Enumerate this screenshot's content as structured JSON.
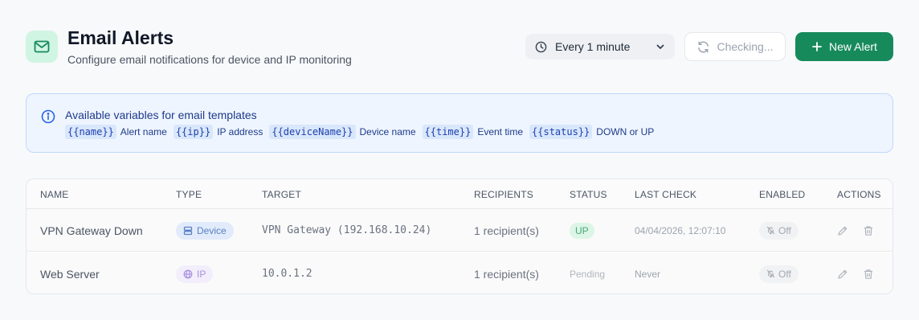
{
  "header": {
    "title": "Email Alerts",
    "subtitle": "Configure email notifications for device and IP monitoring",
    "icon": "mail-icon",
    "accent_color": "#178a5c"
  },
  "toolbar": {
    "interval_label": "Every 1 minute",
    "checking_label": "Checking...",
    "new_alert_label": "New Alert"
  },
  "info": {
    "title": "Available variables for email templates",
    "variables": [
      {
        "code": "{{name}}",
        "desc": "Alert name"
      },
      {
        "code": "{{ip}}",
        "desc": "IP address"
      },
      {
        "code": "{{deviceName}}",
        "desc": "Device name"
      },
      {
        "code": "{{time}}",
        "desc": "Event time"
      },
      {
        "code": "{{status}}",
        "desc": "DOWN or UP"
      }
    ]
  },
  "table": {
    "columns": [
      "NAME",
      "TYPE",
      "TARGET",
      "RECIPIENTS",
      "STATUS",
      "LAST CHECK",
      "ENABLED",
      "ACTIONS"
    ],
    "rows": [
      {
        "name": "VPN Gateway Down",
        "type": "Device",
        "target": "VPN Gateway (192.168.10.24)",
        "recipients": "1 recipient(s)",
        "status": "UP",
        "last_check": "04/04/2026, 12:07:10",
        "enabled": "Off"
      },
      {
        "name": "Web Server",
        "type": "IP",
        "target": "10.0.1.2",
        "recipients": "1 recipient(s)",
        "status": "Pending",
        "last_check": "Never",
        "enabled": "Off"
      }
    ]
  }
}
